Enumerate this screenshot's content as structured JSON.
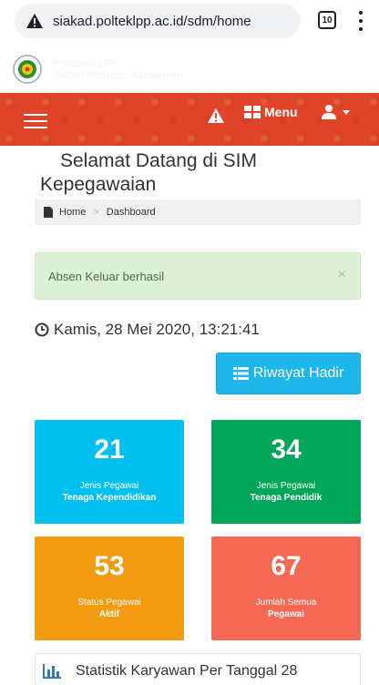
{
  "browser": {
    "url": "siakad.polteklpp.ac.id/sdm/home",
    "tab_count": "10",
    "icons": [
      "warning-icon",
      "tabs-icon",
      "more-vert-icon"
    ]
  },
  "site": {
    "name_line1": "Politeknik LPP",
    "name_line2": "Sistem Informasi Manajemen"
  },
  "navbar": {
    "menu_label": "Menu",
    "color": "#e0452a",
    "icons": [
      "hamburger-icon",
      "warning-icon",
      "grid-icon",
      "user-icon",
      "caret-down-icon"
    ]
  },
  "page": {
    "title": "Selamat Datang di SIM Kepegawaian",
    "breadcrumb": [
      "Home",
      "Dashboard"
    ],
    "breadcrumb_sep": ">"
  },
  "alert": {
    "message": "Absen Keluar berhasil",
    "close": "×"
  },
  "clock": {
    "datetime": "Kamis, 28 Mei 2020, 13:21:41"
  },
  "button": {
    "riwayat_label": "Riwayat Hadir",
    "color": "#1fb7ea"
  },
  "cards": [
    {
      "value": "21",
      "label": "Jenis Pegawai",
      "sub": "Tenaga Kependidikan",
      "color": "#00c0ef"
    },
    {
      "value": "34",
      "label": "Jenis Pegawai",
      "sub": "Tenaga Pendidik",
      "color": "#00a65a"
    },
    {
      "value": "53",
      "label": "Status Pegawai",
      "sub": "Aktif",
      "color": "#f39c12"
    },
    {
      "value": "67",
      "label": "Jumlah Semua",
      "sub": "Pegawai",
      "color": "#f56954"
    }
  ],
  "stats": {
    "title": "Statistik Karyawan Per Tanggal 28"
  }
}
